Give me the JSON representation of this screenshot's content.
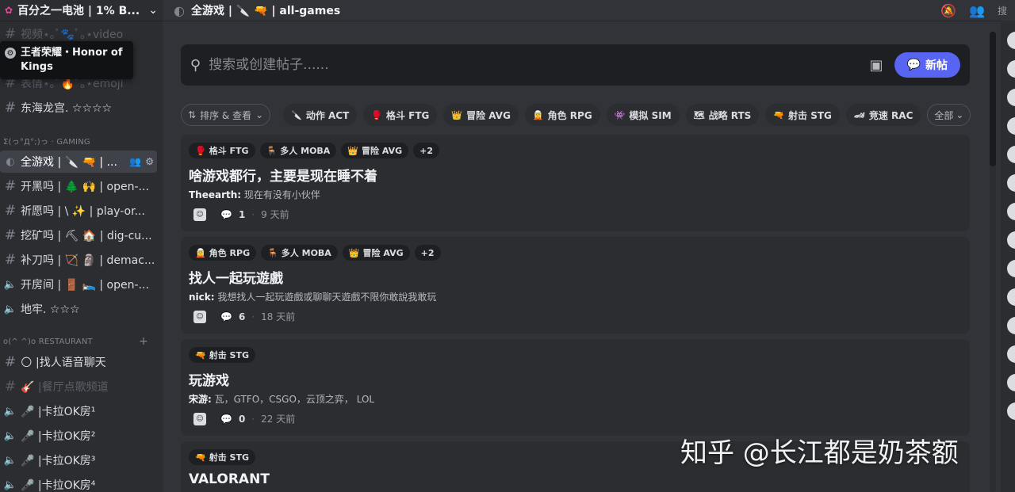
{
  "server": {
    "name": "百分之一电池 | 1% B..."
  },
  "tooltip": {
    "text": "王者荣耀・Honor of Kings"
  },
  "sidebar": {
    "top_channels": [
      {
        "label": "视频⋆｡ﾟ🐾ﾟ｡⋆video"
      },
      {
        "label": "表情⋆｡ﾟ🔥ﾟ｡⋆emoji"
      },
      {
        "label": "东海龙宫. ☆☆☆☆"
      }
    ],
    "cat_gaming": "Σ(っ°Д°;)っ · GAMING",
    "gaming_channels": [
      {
        "label": "全游戏 | 🔪 🔫 | ..."
      },
      {
        "label": "开黑吗 | 🌲 🙌 | open-..."
      },
      {
        "label": "祈愿吗 | \\ ✨ | play-or..."
      },
      {
        "label": "挖矿吗 | ⛏ 🏠 | dig-cu..."
      },
      {
        "label": "补刀吗 | 🏹 🗿 | demac..."
      },
      {
        "label": "开房间 | 🚪 🛌 | open-..."
      },
      {
        "label": "地牢. ☆☆☆"
      }
    ],
    "cat_restaurant": "o(^ ^)o RESTAURANT",
    "restaurant_channels": [
      {
        "label": "🌕 |找人语音聊天"
      },
      {
        "label": "🎸 |餐厅点歌频道"
      },
      {
        "label": "🎤 |卡拉OK房¹"
      },
      {
        "label": "🎤 |卡拉OK房²"
      },
      {
        "label": "🎤 |卡拉OK房³"
      },
      {
        "label": "🎤 |卡拉OK房⁴"
      }
    ]
  },
  "topbar": {
    "title": "全游戏 | 🔪 🔫 | all-games",
    "search_label": "搜"
  },
  "search": {
    "placeholder": "搜索或创建帖子......",
    "new_post": "新帖"
  },
  "tagbar": {
    "sort": "排序 & 查看",
    "tags": [
      {
        "emoji": "🔪",
        "label": "动作 ACT"
      },
      {
        "emoji": "🥊",
        "label": "格斗 FTG"
      },
      {
        "emoji": "👑",
        "label": "冒险 AVG"
      },
      {
        "emoji": "🧝",
        "label": "角色 RPG"
      },
      {
        "emoji": "👾",
        "label": "模拟 SIM"
      },
      {
        "emoji": "🗺",
        "label": "战略 RTS"
      },
      {
        "emoji": "🔫",
        "label": "射击 STG"
      },
      {
        "emoji": "🏎",
        "label": "竞速 RAC"
      }
    ],
    "all": "全部"
  },
  "posts": [
    {
      "tags": [
        {
          "emoji": "🥊",
          "label": "格斗 FTG"
        },
        {
          "emoji": "🪑",
          "label": "多人 MOBA"
        },
        {
          "emoji": "👑",
          "label": "冒险 AVG"
        },
        {
          "emoji": "",
          "label": "+2"
        }
      ],
      "title": "啥游戏都行，主要是现在睡不着",
      "author": "Theearth:",
      "preview": " 现在有没有小伙伴",
      "count": "1",
      "time": "9 天前"
    },
    {
      "tags": [
        {
          "emoji": "🧝",
          "label": "角色 RPG"
        },
        {
          "emoji": "🪑",
          "label": "多人 MOBA"
        },
        {
          "emoji": "👑",
          "label": "冒险 AVG"
        },
        {
          "emoji": "",
          "label": "+2"
        }
      ],
      "title": "找人一起玩遊戲",
      "author": "nick:",
      "preview": " 我想找人一起玩遊戲或聊聊天遊戲不限你敢說我敢玩",
      "count": "6",
      "time": "18 天前"
    },
    {
      "tags": [
        {
          "emoji": "🔫",
          "label": "射击 STG"
        }
      ],
      "title": "玩游戏",
      "author": "宋游:",
      "preview": " 瓦，GTFO，CSGO，云顶之弈， LOL",
      "count": "0",
      "time": "22 天前"
    },
    {
      "tags": [
        {
          "emoji": "🔫",
          "label": "射击 STG"
        }
      ],
      "title": "VALORANT",
      "author": "",
      "preview": "",
      "count": "",
      "time": ""
    }
  ],
  "watermark": "知乎 @长江都是奶茶额"
}
